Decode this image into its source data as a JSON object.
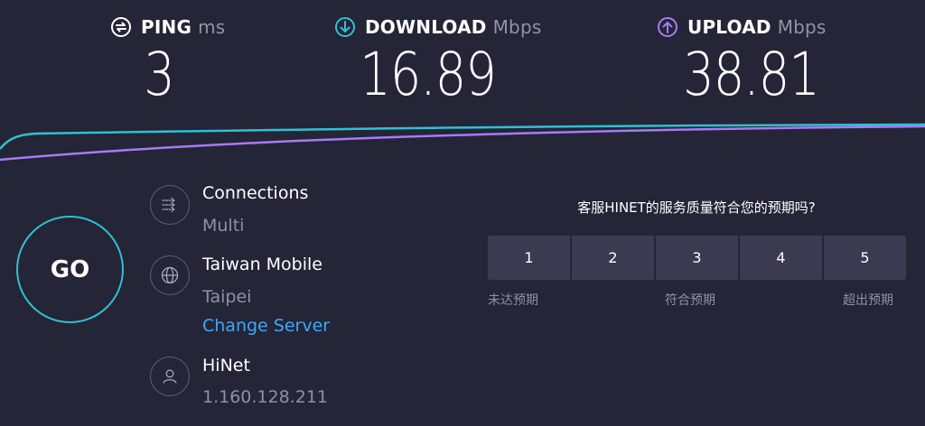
{
  "metrics": {
    "ping": {
      "label": "PING",
      "unit": "ms",
      "value": "3",
      "color": "#ffffff"
    },
    "download": {
      "label": "DOWNLOAD",
      "unit": "Mbps",
      "value": "16.89",
      "color": "#2fc0d4"
    },
    "upload": {
      "label": "UPLOAD",
      "unit": "Mbps",
      "value": "38.81",
      "color": "#a77bf3"
    }
  },
  "go_button": {
    "label": "GO"
  },
  "connections": {
    "title": "Connections",
    "value": "Multi",
    "icon": "connections-icon"
  },
  "server": {
    "title": "Taiwan Mobile",
    "location": "Taipei",
    "change_label": "Change Server",
    "icon": "globe-icon"
  },
  "provider": {
    "title": "HiNet",
    "ip": "1.160.128.211",
    "icon": "user-icon"
  },
  "survey": {
    "question": "客服HINET的服务质量符合您的预期吗?",
    "options": [
      "1",
      "2",
      "3",
      "4",
      "5"
    ],
    "low_label": "未达预期",
    "mid_label": "符合预期",
    "high_label": "超出预期"
  },
  "colors": {
    "background": "#242537",
    "download_line": "#2fc0d4",
    "upload_line": "#a77bf3",
    "link": "#3fa9f5"
  }
}
